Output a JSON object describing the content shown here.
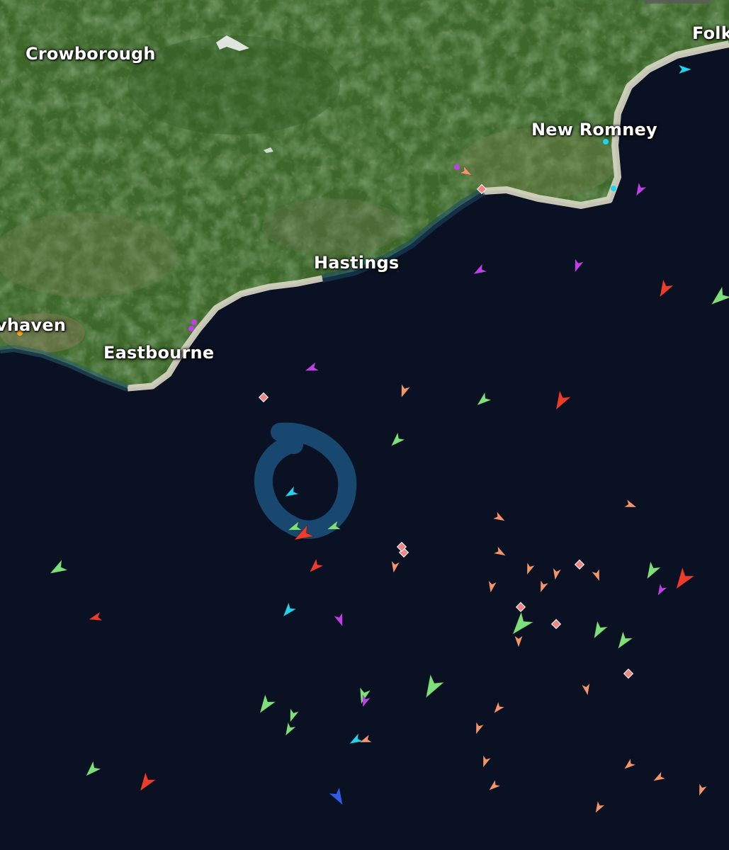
{
  "map": {
    "place_labels": {
      "crowborough": "Crowborough",
      "newhaven": "vhaven",
      "eastbourne": "Eastbourne",
      "hastings": "Hastings",
      "new_romney": "New Romney",
      "folkestone": "Folk"
    },
    "colors": {
      "sea": "#0a1122",
      "land": "#3f6a2c",
      "beach": "#d8d8c2",
      "vessel_passenger": "#22d3ee",
      "vessel_cargo": "#7ee07a",
      "vessel_tanker": "#ef3b2c",
      "vessel_fishing": "#f4956a",
      "vessel_pleasure": "#c040e8",
      "vessel_highspeed": "#2f5ee8",
      "vessel_anchored": "#f08585",
      "highlight_ring": "#1a4f78"
    }
  }
}
